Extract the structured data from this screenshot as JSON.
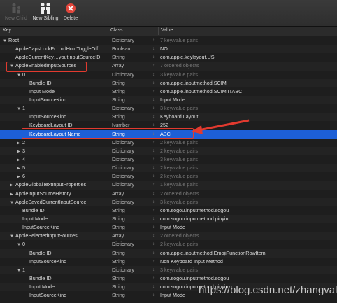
{
  "toolbar": {
    "new_child": "New Child",
    "new_sibling": "New Sibling",
    "delete": "Delete"
  },
  "columns": {
    "key": "Key",
    "class": "Class",
    "value": "Value"
  },
  "colors": {
    "selection": "#1d5fd6",
    "highlight": "#e23a2f"
  },
  "rows": [
    {
      "indent": 0,
      "tri": "open",
      "key": "Root",
      "type": "Dictionary",
      "value": "7 key/value pairs",
      "gray": true
    },
    {
      "indent": 1,
      "tri": "",
      "key": "AppleCapsLockPr…ndHoldToggleOff",
      "type": "Boolean",
      "value": "NO",
      "gray": false
    },
    {
      "indent": 1,
      "tri": "",
      "key": "AppleCurrentKey…youtInputSourceID",
      "type": "String",
      "value": "com.apple.keylayout.US",
      "gray": false
    },
    {
      "indent": 1,
      "tri": "open",
      "key": "AppleEnabledInputSources",
      "type": "Array",
      "value": "7 ordered objects",
      "gray": true
    },
    {
      "indent": 2,
      "tri": "open",
      "key": "0",
      "type": "Dictionary",
      "value": "3 key/value pairs",
      "gray": true
    },
    {
      "indent": 3,
      "tri": "",
      "key": "Bundle ID",
      "type": "String",
      "value": "com.apple.inputmethod.SCIM",
      "gray": false
    },
    {
      "indent": 3,
      "tri": "",
      "key": "Input Mode",
      "type": "String",
      "value": "com.apple.inputmethod.SCIM.ITABC",
      "gray": false
    },
    {
      "indent": 3,
      "tri": "",
      "key": "InputSourceKind",
      "type": "String",
      "value": "Input Mode",
      "gray": false
    },
    {
      "indent": 2,
      "tri": "open",
      "key": "1",
      "type": "Dictionary",
      "value": "3 key/value pairs",
      "gray": true
    },
    {
      "indent": 3,
      "tri": "",
      "key": "InputSourceKind",
      "type": "String",
      "value": "Keyboard Layout",
      "gray": false
    },
    {
      "indent": 3,
      "tri": "",
      "key": "KeyboardLayout ID",
      "type": "Number",
      "value": "252",
      "gray": false
    },
    {
      "indent": 3,
      "tri": "",
      "key": "KeyboardLayout Name",
      "type": "String",
      "value": "ABC",
      "gray": false,
      "selected": true
    },
    {
      "indent": 2,
      "tri": "closed",
      "key": "2",
      "type": "Dictionary",
      "value": "2 key/value pairs",
      "gray": true
    },
    {
      "indent": 2,
      "tri": "closed",
      "key": "3",
      "type": "Dictionary",
      "value": "2 key/value pairs",
      "gray": true
    },
    {
      "indent": 2,
      "tri": "closed",
      "key": "4",
      "type": "Dictionary",
      "value": "3 key/value pairs",
      "gray": true
    },
    {
      "indent": 2,
      "tri": "closed",
      "key": "5",
      "type": "Dictionary",
      "value": "2 key/value pairs",
      "gray": true
    },
    {
      "indent": 2,
      "tri": "closed",
      "key": "6",
      "type": "Dictionary",
      "value": "2 key/value pairs",
      "gray": true
    },
    {
      "indent": 1,
      "tri": "closed",
      "key": "AppleGlobalTextInputProperties",
      "type": "Dictionary",
      "value": "1 key/value pairs",
      "gray": true
    },
    {
      "indent": 1,
      "tri": "closed",
      "key": "AppleInputSourceHistory",
      "type": "Array",
      "value": "2 ordered objects",
      "gray": true
    },
    {
      "indent": 1,
      "tri": "open",
      "key": "AppleSavedCurrentInputSource",
      "type": "Dictionary",
      "value": "3 key/value pairs",
      "gray": true
    },
    {
      "indent": 2,
      "tri": "",
      "key": "Bundle ID",
      "type": "String",
      "value": "com.sogou.inputmethod.sogou",
      "gray": false
    },
    {
      "indent": 2,
      "tri": "",
      "key": "Input Mode",
      "type": "String",
      "value": "com.sogou.inputmethod.pinyin",
      "gray": false
    },
    {
      "indent": 2,
      "tri": "",
      "key": "InputSourceKind",
      "type": "String",
      "value": "Input Mode",
      "gray": false
    },
    {
      "indent": 1,
      "tri": "open",
      "key": "AppleSelectedInputSources",
      "type": "Array",
      "value": "2 ordered objects",
      "gray": true
    },
    {
      "indent": 2,
      "tri": "open",
      "key": "0",
      "type": "Dictionary",
      "value": "2 key/value pairs",
      "gray": true
    },
    {
      "indent": 3,
      "tri": "",
      "key": "Bundle ID",
      "type": "String",
      "value": "com.apple.inputmethod.EmojiFunctionRowItem",
      "gray": false
    },
    {
      "indent": 3,
      "tri": "",
      "key": "InputSourceKind",
      "type": "String",
      "value": "Non Keyboard Input Method",
      "gray": false
    },
    {
      "indent": 2,
      "tri": "open",
      "key": "1",
      "type": "Dictionary",
      "value": "3 key/value pairs",
      "gray": true
    },
    {
      "indent": 3,
      "tri": "",
      "key": "Bundle ID",
      "type": "String",
      "value": "com.sogou.inputmethod.sogou",
      "gray": false
    },
    {
      "indent": 3,
      "tri": "",
      "key": "Input Mode",
      "type": "String",
      "value": "com.sogou.inputmethod.pinyin",
      "gray": false
    },
    {
      "indent": 3,
      "tri": "",
      "key": "InputSourceKind",
      "type": "String",
      "value": "Input Mode",
      "gray": false
    }
  ],
  "watermark": "https://blog.csdn.net/zhangvalue"
}
